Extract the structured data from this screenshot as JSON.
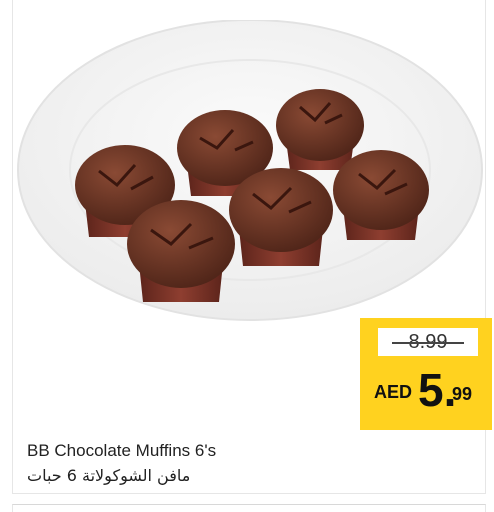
{
  "product": {
    "name_en": "BB Chocolate Muffins 6's",
    "name_ar": "مافن الشوكولاتة 6 حبات",
    "image_icon": "chocolate-muffins-plate-image"
  },
  "price": {
    "old": "8.99",
    "currency": "AED",
    "new_int": "5.",
    "new_dec": "99"
  },
  "colors": {
    "price_tag": "#ffd21f",
    "muffin": "#6b3425",
    "plate": "#f4f4f4"
  }
}
